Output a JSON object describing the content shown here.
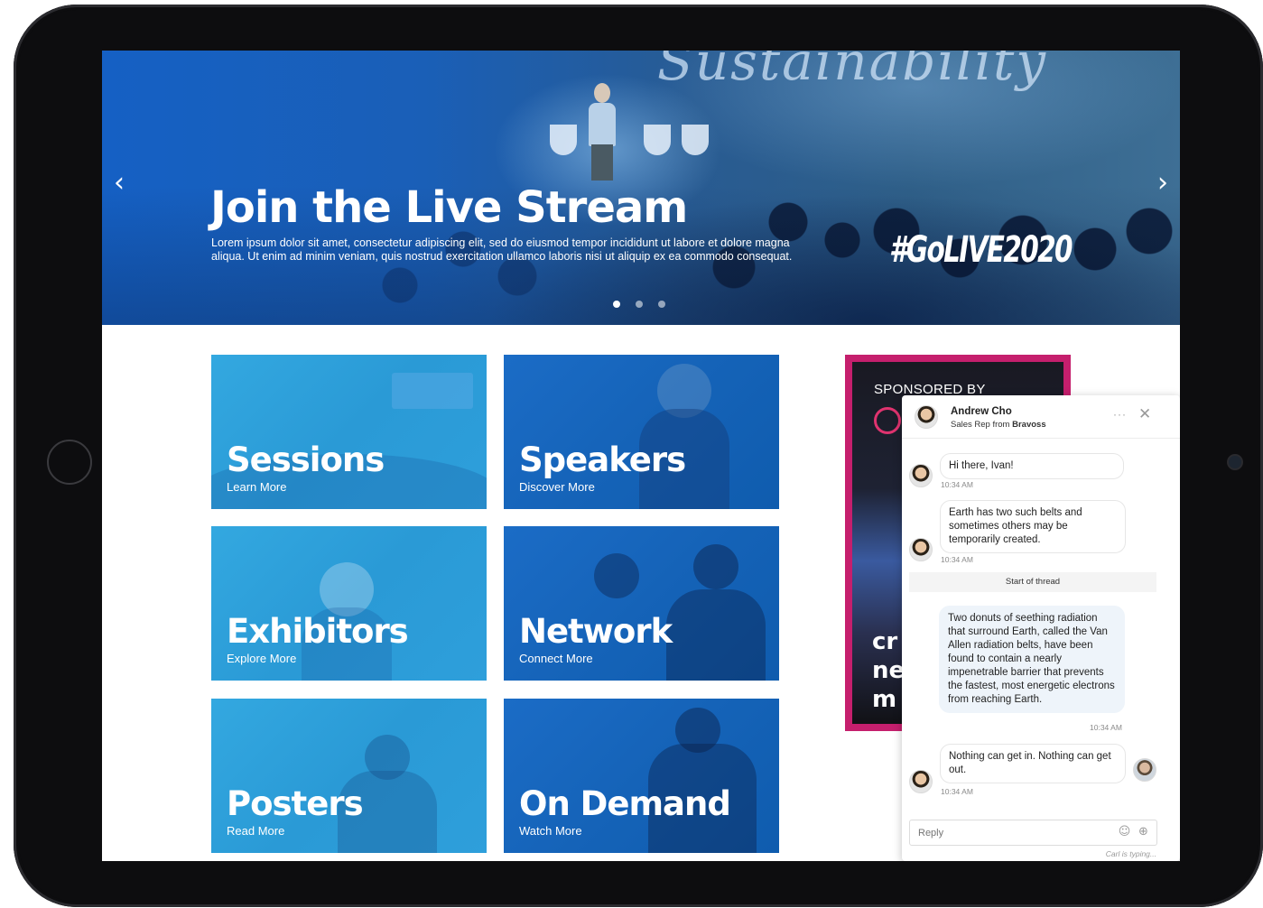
{
  "hero": {
    "background_word": "Sustainability",
    "title": "Join the Live Stream",
    "description": "Lorem ipsum dolor sit amet, consectetur adipiscing elit, sed do eiusmod tempor incididunt ut labore et dolore magna aliqua. Ut enim ad minim veniam, quis nostrud exercitation ullamco laboris nisi ut aliquip ex ea commodo consequat.",
    "hashtag": "#GoLIVE2020",
    "prev_arrow": "‹",
    "next_arrow": "›",
    "slide_count": 3,
    "active_slide": 1
  },
  "tiles": [
    {
      "title": "Sessions",
      "subtitle": "Learn More"
    },
    {
      "title": "Speakers",
      "subtitle": "Discover More"
    },
    {
      "title": "Exhibitors",
      "subtitle": "Explore More"
    },
    {
      "title": "Network",
      "subtitle": "Connect More"
    },
    {
      "title": "Posters",
      "subtitle": "Read More"
    },
    {
      "title": "On Demand",
      "subtitle": "Watch More"
    }
  ],
  "sponsor": {
    "label": "SPONSORED BY",
    "partial_text": "cr\nne\nm",
    "accent_color": "#c51f6d"
  },
  "chat": {
    "contact_name": "Andrew Cho",
    "contact_role_prefix": "Sales Rep from",
    "contact_company": "Bravoss",
    "more_icon": "···",
    "close_icon": "✕",
    "messages": [
      {
        "text": "Hi there, Ivan!",
        "time": "10:34 AM"
      },
      {
        "text": "Earth has two such belts and sometimes others may be temporarily created.",
        "time": "10:34 AM"
      },
      {
        "text": "Two donuts of seething radiation that surround Earth, called the Van Allen radiation belts, have been found to contain a nearly impenetrable barrier that prevents the fastest, most energetic electrons from reaching Earth.",
        "time": "10:34 AM"
      },
      {
        "text": "Nothing can get in. Nothing can get out.",
        "time": "10:34 AM"
      }
    ],
    "thread_label": "Start of thread",
    "reply_placeholder": "Reply",
    "emoji_icon": "☺",
    "add_icon": "⊕",
    "typing_status": "Carl is typing..."
  }
}
